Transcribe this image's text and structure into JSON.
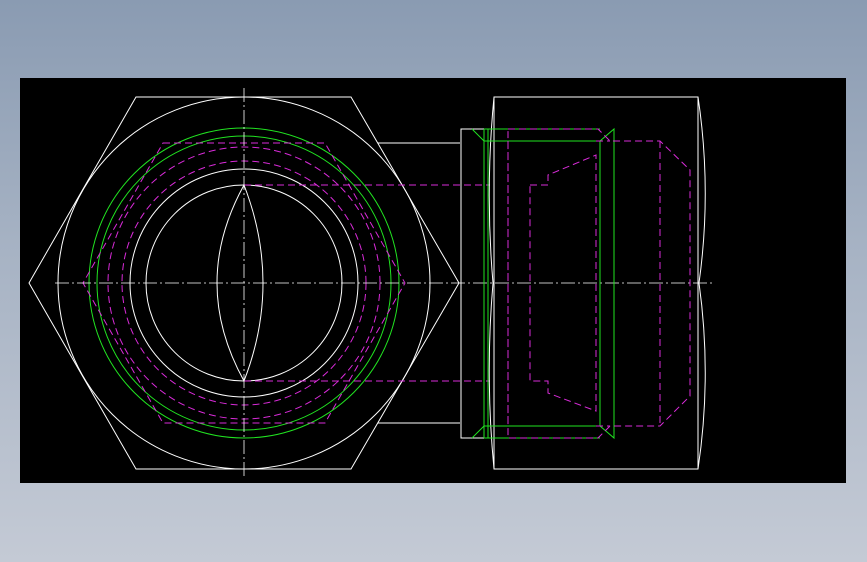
{
  "viewer": {
    "background": "#000000",
    "colors": {
      "outline": "#ffffff",
      "thread": "#21e321",
      "hidden": "#d92bd9"
    }
  },
  "drawing": {
    "views": [
      "front-view",
      "side-view"
    ],
    "line_types": [
      "continuous",
      "hidden-dashed",
      "center-dash-dot"
    ]
  }
}
